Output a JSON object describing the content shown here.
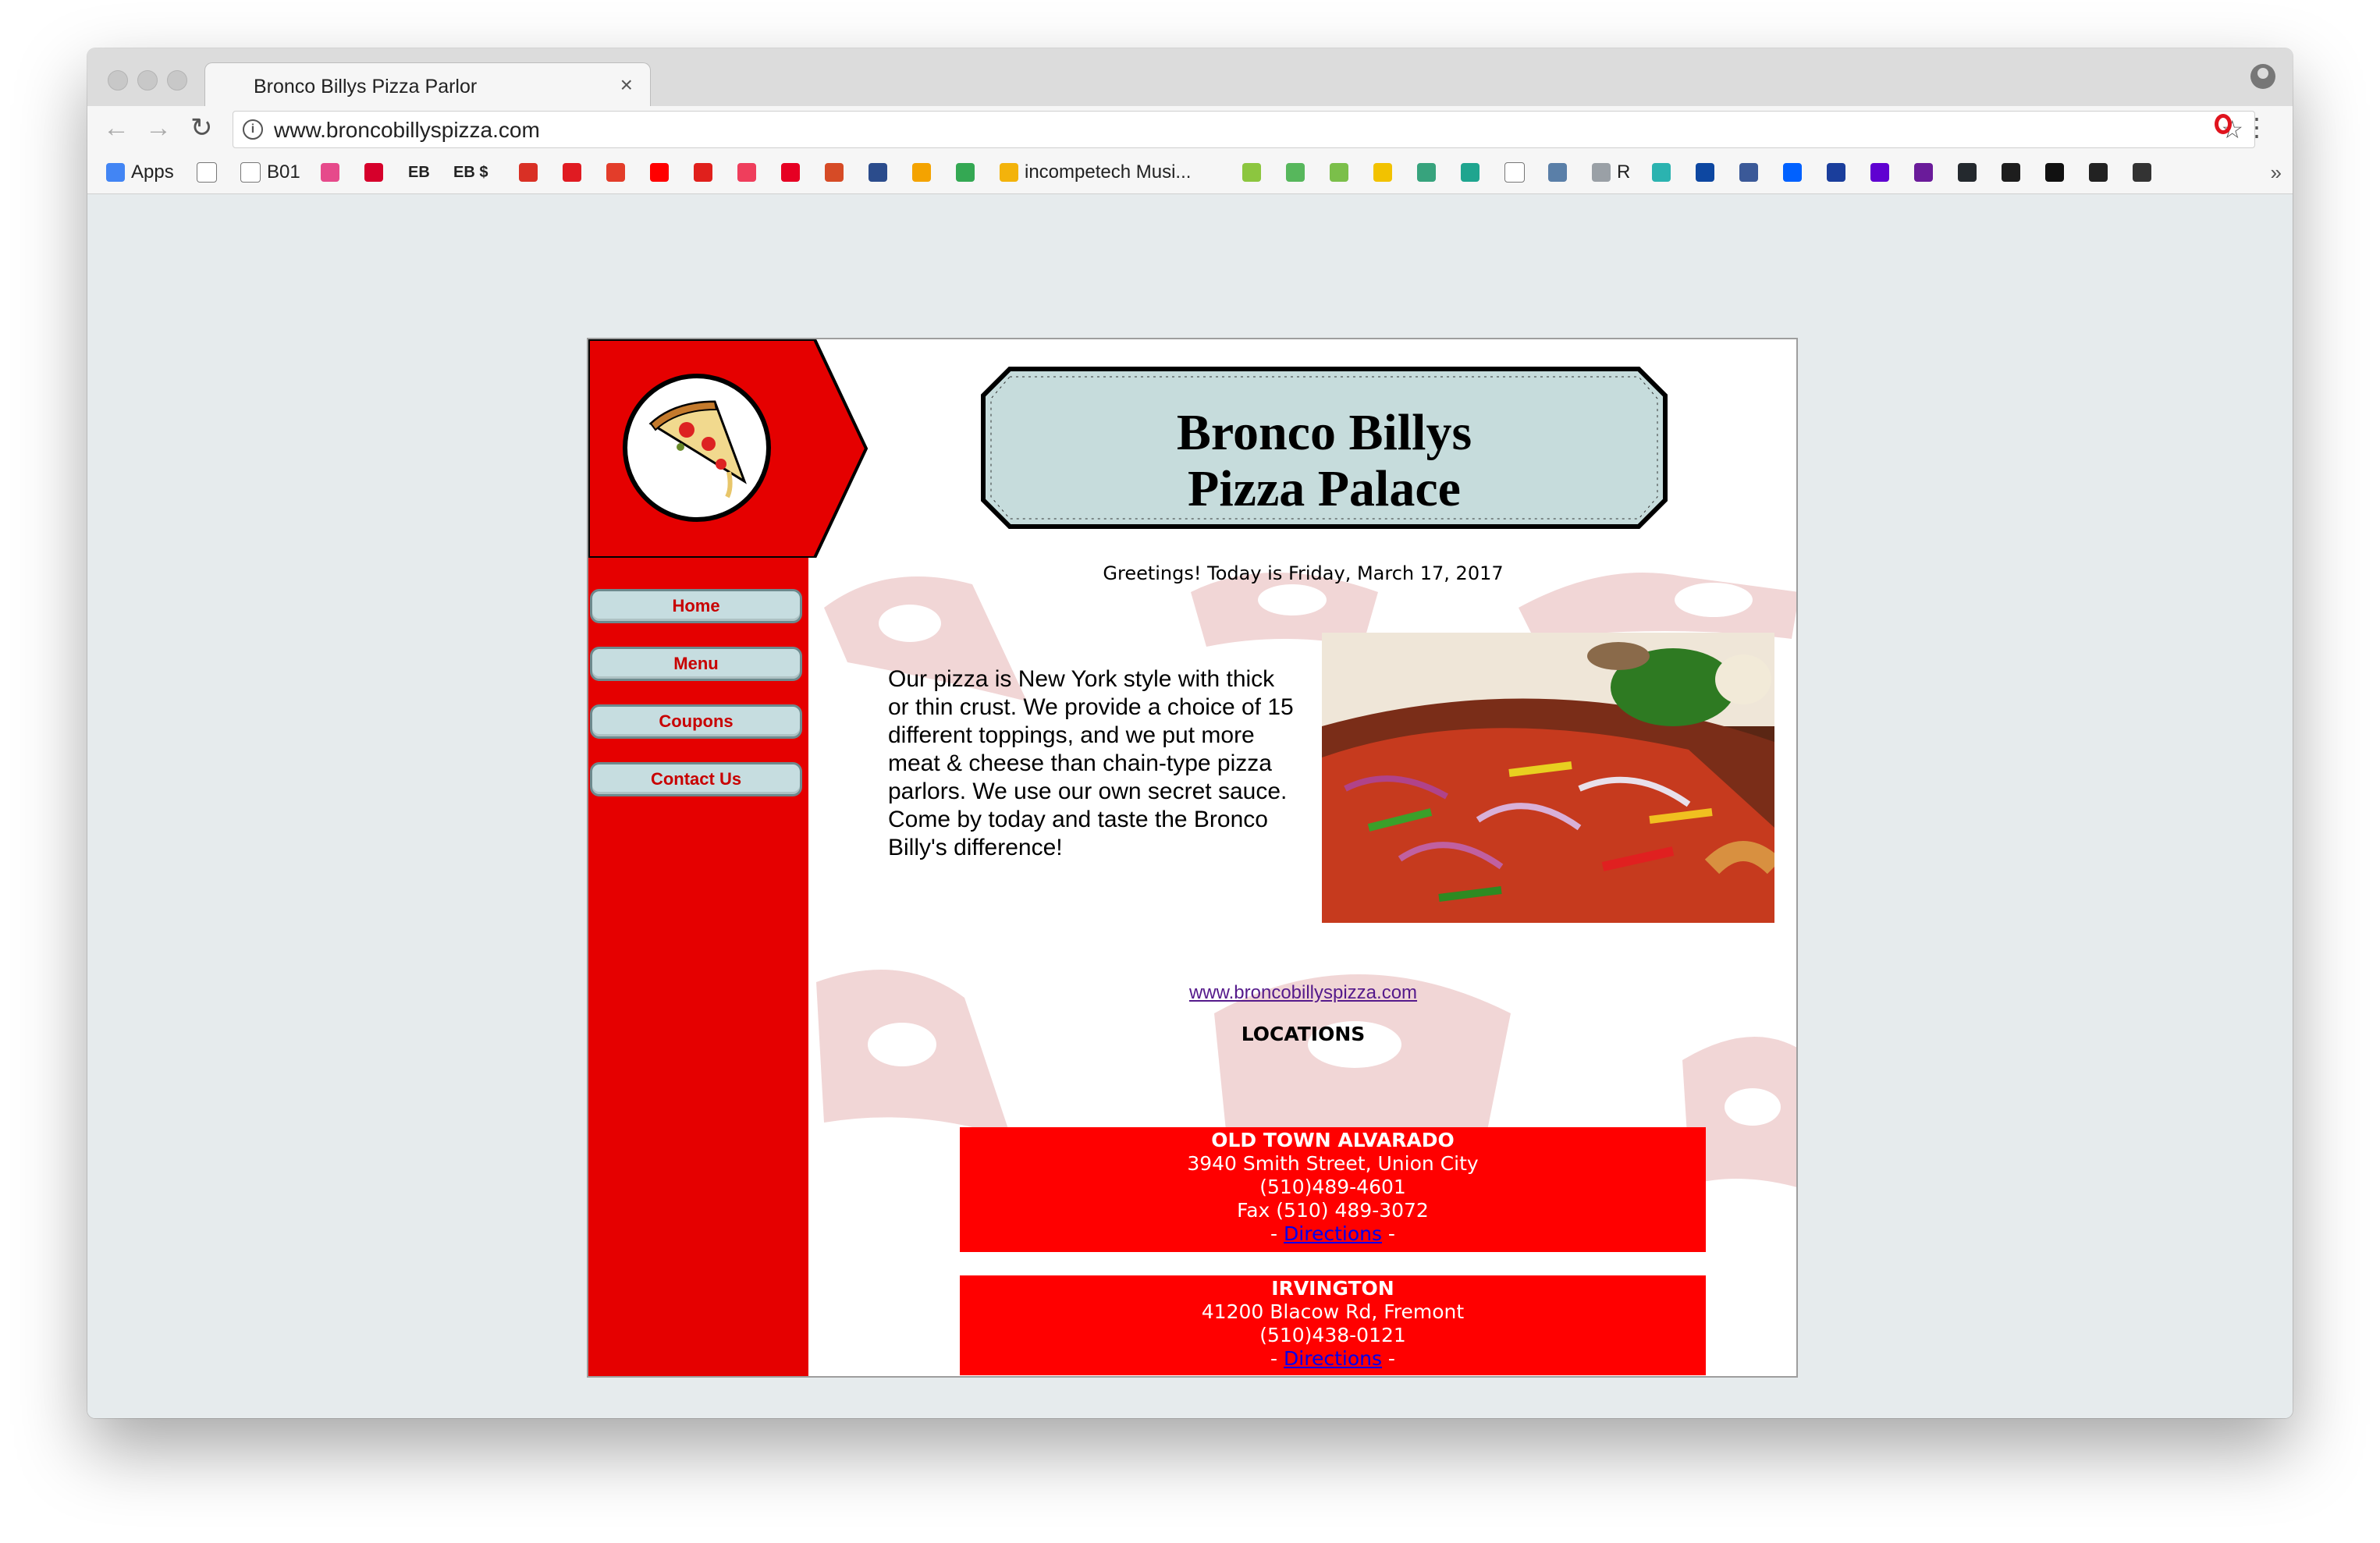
{
  "browser": {
    "tab_title": "Bronco Billys Pizza Parlor",
    "tab_close": "×",
    "url": "www.broncobillyspizza.com",
    "nav": {
      "back": "←",
      "forward": "→",
      "reload": "↻"
    },
    "bookmarks": [
      {
        "label": "Apps",
        "icon": "apps-grid-icon",
        "color": "#4285f4"
      },
      {
        "label": "",
        "icon": "page-icon",
        "color": "#ffffff"
      },
      {
        "label": "B01",
        "icon": "page-icon",
        "color": "#ffffff"
      },
      {
        "label": "",
        "icon": "pink-icon",
        "color": "#e64a8b"
      },
      {
        "label": "",
        "icon": "bank-icon",
        "color": "#d6002b"
      },
      {
        "label": "EB",
        "icon": "",
        "color": ""
      },
      {
        "label": "EB $",
        "icon": "",
        "color": ""
      },
      {
        "label": "",
        "icon": "gmail-icon",
        "color": "#d93025"
      },
      {
        "label": "",
        "icon": "adobe-icon",
        "color": "#e01b22"
      },
      {
        "label": "",
        "icon": "office-icon",
        "color": "#e33d2a"
      },
      {
        "label": "",
        "icon": "youtube-icon",
        "color": "#ff0000"
      },
      {
        "label": "",
        "icon": "red-circle-icon",
        "color": "#e0201c"
      },
      {
        "label": "",
        "icon": "p-icon",
        "color": "#ef3e5c"
      },
      {
        "label": "",
        "icon": "pinterest-icon",
        "color": "#e60023"
      },
      {
        "label": "",
        "icon": "ui-icon",
        "color": "#d64b26"
      },
      {
        "label": "",
        "icon": "flag-icon",
        "color": "#2b4c8c"
      },
      {
        "label": "",
        "icon": "p-orange-icon",
        "color": "#f4a300"
      },
      {
        "label": "",
        "icon": "drive-icon",
        "color": "#34a853"
      },
      {
        "label": "incompetech Musi...",
        "icon": "play-icon",
        "color": "#f3b30b"
      },
      {
        "label": "",
        "icon": "green-icon",
        "color": "#8cc63f"
      },
      {
        "label": "",
        "icon": "green2-icon",
        "color": "#57b75c"
      },
      {
        "label": "",
        "icon": "green3-icon",
        "color": "#7bbf4a"
      },
      {
        "label": "",
        "icon": "yellow-icon",
        "color": "#f2c200"
      },
      {
        "label": "",
        "icon": "leaf-icon",
        "color": "#37a37d"
      },
      {
        "label": "",
        "icon": "teal-icon",
        "color": "#1fa58f"
      },
      {
        "label": "",
        "icon": "c-icon",
        "color": "#ffffff"
      },
      {
        "label": "",
        "icon": "calc-icon",
        "color": "#5a7fa8"
      },
      {
        "label": "R",
        "icon": "folder-icon",
        "color": "#9aa0a6"
      },
      {
        "label": "",
        "icon": "swirl-icon",
        "color": "#2bb3b0"
      },
      {
        "label": "",
        "icon": "blue-circle-icon",
        "color": "#0d47a1"
      },
      {
        "label": "",
        "icon": "facebook-icon",
        "color": "#3b5998"
      },
      {
        "label": "",
        "icon": "dropbox-icon",
        "color": "#0061ff"
      },
      {
        "label": "",
        "icon": "calendar-icon",
        "color": "#1a3e9c"
      },
      {
        "label": "",
        "icon": "yahoo-icon",
        "color": "#5f01d1"
      },
      {
        "label": "",
        "icon": "peace-icon",
        "color": "#6a1b9a"
      },
      {
        "label": "",
        "icon": "github-icon",
        "color": "#24292e"
      },
      {
        "label": "",
        "icon": "spotify-icon",
        "color": "#1d1d1d"
      },
      {
        "label": "",
        "icon": "d-icon",
        "color": "#111111"
      },
      {
        "label": "",
        "icon": "we-icon",
        "color": "#222222"
      },
      {
        "label": "",
        "icon": "bb-icon",
        "color": "#333333"
      }
    ],
    "bookmarks_more": "»"
  },
  "site": {
    "title_line1": "Bronco Billys",
    "title_line2": "Pizza Palace",
    "greeting": "Greetings! Today is Friday, March 17, 2017",
    "nav": [
      {
        "label": "Home",
        "name": "nav-home-button"
      },
      {
        "label": "Menu",
        "name": "nav-menu-button"
      },
      {
        "label": "Coupons",
        "name": "nav-coupons-button"
      },
      {
        "label": "Contact Us",
        "name": "nav-contact-us-button"
      }
    ],
    "intro": "Our pizza is New York style with thick or thin crust. We provide a choice of 15 different toppings, and we put more meat & cheese than chain-type pizza parlors. We use our own secret sauce. Come by today and taste the Bronco Billy's difference!",
    "link": "www.broncobillyspizza.com",
    "locations_heading": "LOCATIONS",
    "locations": [
      {
        "name": "OLD TOWN ALVARADO",
        "address": "3940 Smith Street, Union City",
        "phone": "(510)489-4601",
        "fax": "Fax (510) 489-3072",
        "directions": "Directions"
      },
      {
        "name": "IRVINGTON",
        "address": "41200 Blacow Rd, Fremont",
        "phone": "(510)438-0121",
        "directions": "Directions"
      }
    ],
    "colors": {
      "sidebar": "#e50000",
      "location_box": "#ff0000",
      "banner": "#c6dcdc",
      "nav_button": "#c6dde0"
    }
  }
}
